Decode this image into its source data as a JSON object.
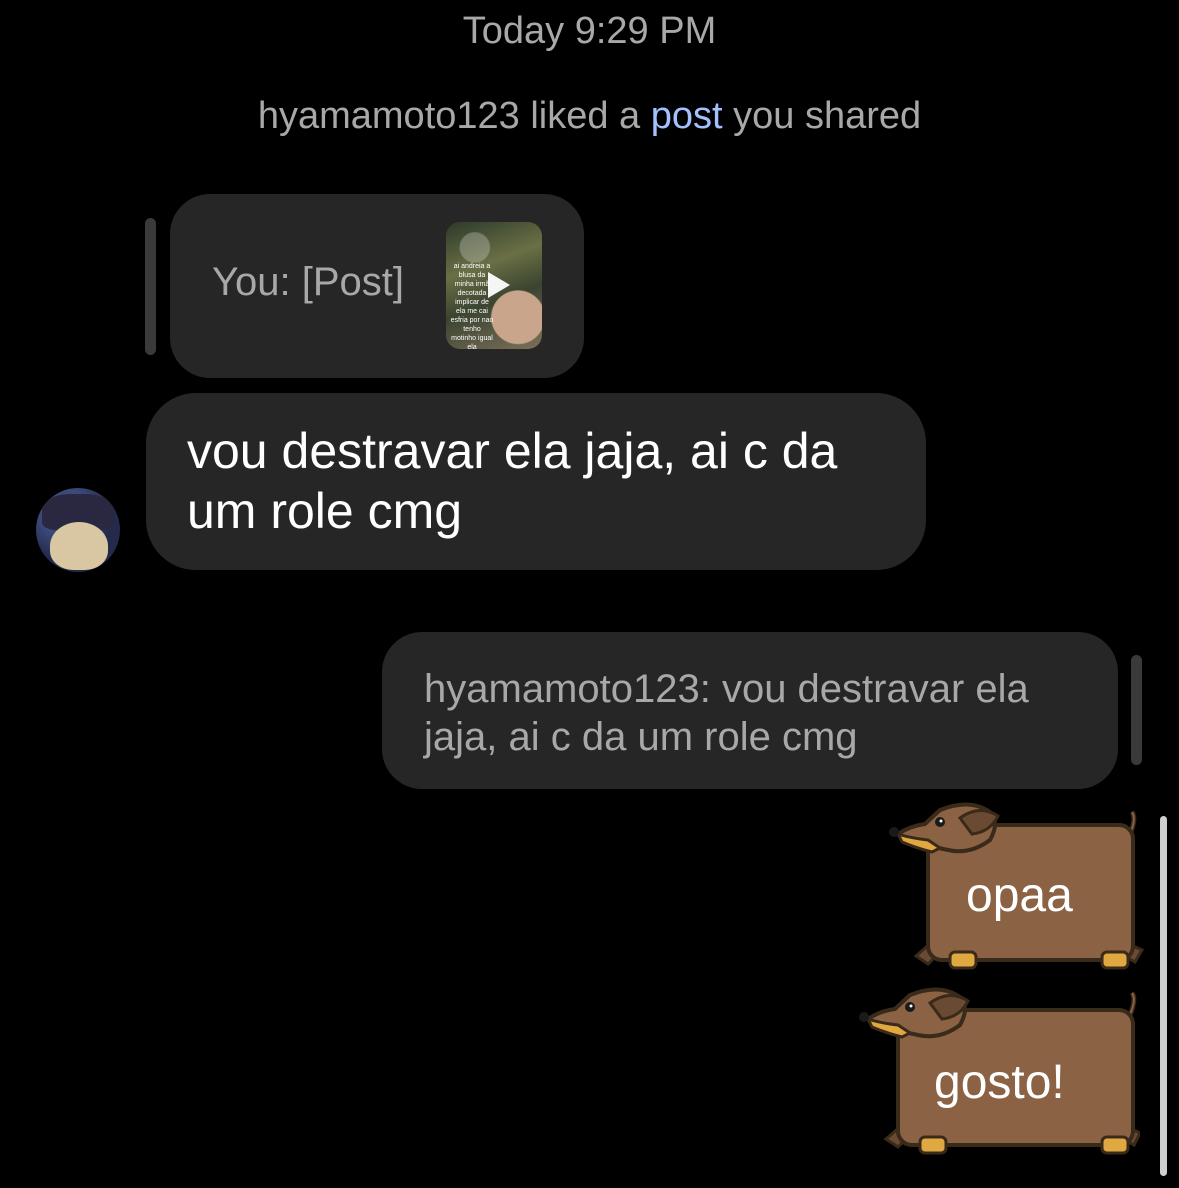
{
  "header": {
    "timestamp": "Today 9:29 PM"
  },
  "activity": {
    "prefix": "hyamamoto123 liked a ",
    "link": "post",
    "suffix": " you shared"
  },
  "thread": {
    "quoted_post": {
      "text": "You: [Post]",
      "thumbnail_caption": "ai andreia a blusa da minha irmã decotada implicar de ela me cai esfria por nao tenho motinho igual ela"
    },
    "incoming_message": {
      "text": "vou destravar ela jaja, ai c da um role cmg",
      "sender_avatar": "avatar"
    },
    "reply_quote": {
      "text": "hyamamoto123: vou destravar ela jaja, ai c da um role cmg"
    },
    "outgoing_messages": [
      {
        "text": "opaa"
      },
      {
        "text": "gosto!"
      }
    ]
  },
  "colors": {
    "background": "#000000",
    "bubble": "#262626",
    "meta_text": "#a8a8a8",
    "link": "#a3c1ff",
    "dog_body": "#8b6244",
    "dog_outline": "#3a2a1a"
  }
}
